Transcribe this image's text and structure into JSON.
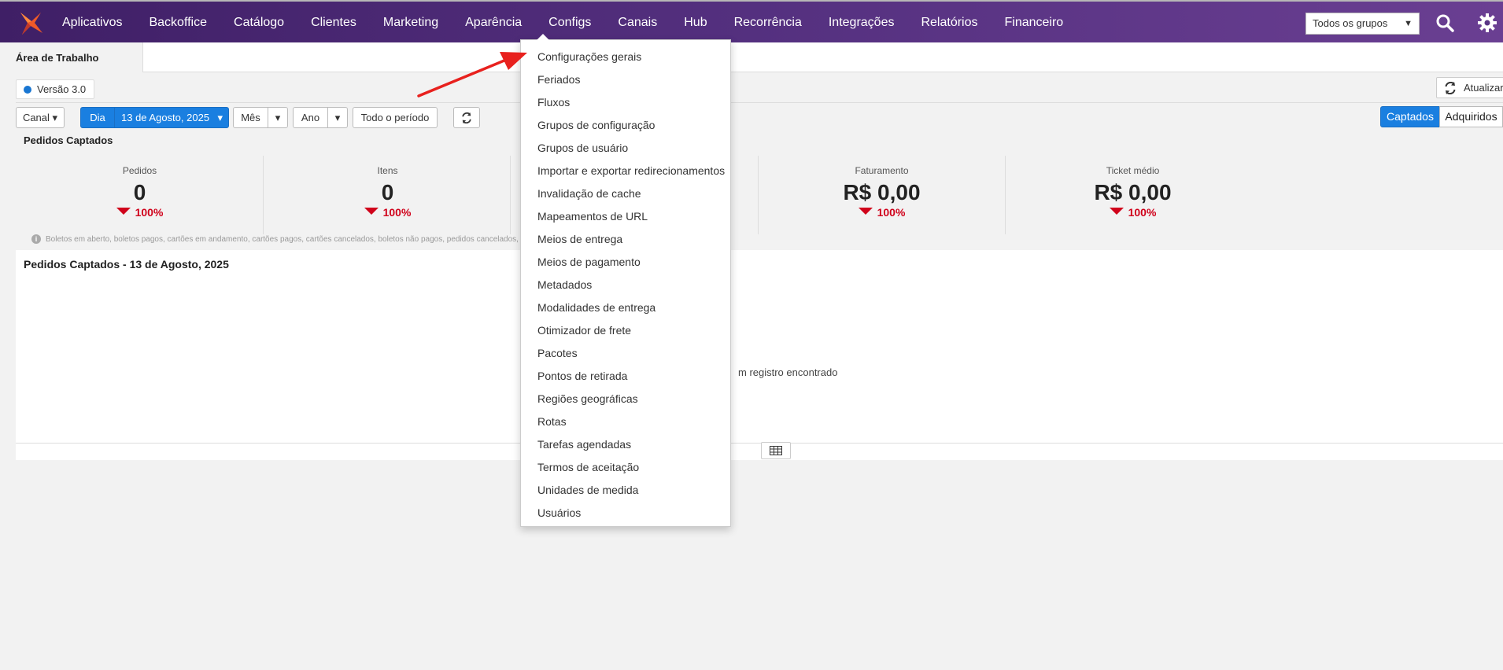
{
  "nav": {
    "items": [
      "Aplicativos",
      "Backoffice",
      "Catálogo",
      "Clientes",
      "Marketing",
      "Aparência",
      "Configs",
      "Canais",
      "Hub",
      "Recorrência",
      "Integrações",
      "Relatórios",
      "Financeiro"
    ],
    "active": "Configs",
    "group_select": "Todos os grupos"
  },
  "tabs": {
    "active": "Área de Trabalho"
  },
  "version": "Versão 3.0",
  "refresh_label": "Atualizar",
  "filters": {
    "canal": "Canal",
    "dia": "Dia",
    "date": "13 de Agosto, 2025",
    "mes": "Mês",
    "ano": "Ano",
    "todo": "Todo o período"
  },
  "toggle": {
    "captados": "Captados",
    "adquiridos": "Adquiridos"
  },
  "section_title": "Pedidos Captados",
  "kpis": [
    {
      "label": "Pedidos",
      "value": "0",
      "delta": "100%"
    },
    {
      "label": "Itens",
      "value": "0",
      "delta": "100%"
    },
    {
      "label": "Faturamento",
      "value": "R$ 0,00",
      "delta": "100%"
    },
    {
      "label": "Ticket médio",
      "value": "R$ 0,00",
      "delta": "100%"
    }
  ],
  "footnote": "Boletos em aberto, boletos pagos, cartões em andamento, cartões pagos, cartões cancelados, boletos não pagos, pedidos cancelados, estorno, dev",
  "panel": {
    "title": "Pedidos Captados - 13 de Agosto, 2025",
    "empty": "m registro encontrado"
  },
  "dropdown": {
    "items": [
      "Configurações gerais",
      "Feriados",
      "Fluxos",
      "Grupos de configuração",
      "Grupos de usuário",
      "Importar e exportar redirecionamentos",
      "Invalidação de cache",
      "Mapeamentos de URL",
      "Meios de entrega",
      "Meios de pagamento",
      "Metadados",
      "Modalidades de entrega",
      "Otimizador de frete",
      "Pacotes",
      "Pontos de retirada",
      "Regiões geográficas",
      "Rotas",
      "Tarefas agendadas",
      "Termos de aceitação",
      "Unidades de medida",
      "Usuários"
    ]
  },
  "colors": {
    "nav_start": "#3f1f66",
    "nav_end": "#6a3f92",
    "primary": "#1a7fe0",
    "negative": "#d0021b",
    "arrow": "#e8211e"
  },
  "icons": {
    "logo": "brand-logo-icon",
    "search": "search-icon",
    "settings": "gear-icon",
    "refresh": "refresh-icon",
    "table": "table-icon",
    "info": "info-icon"
  }
}
